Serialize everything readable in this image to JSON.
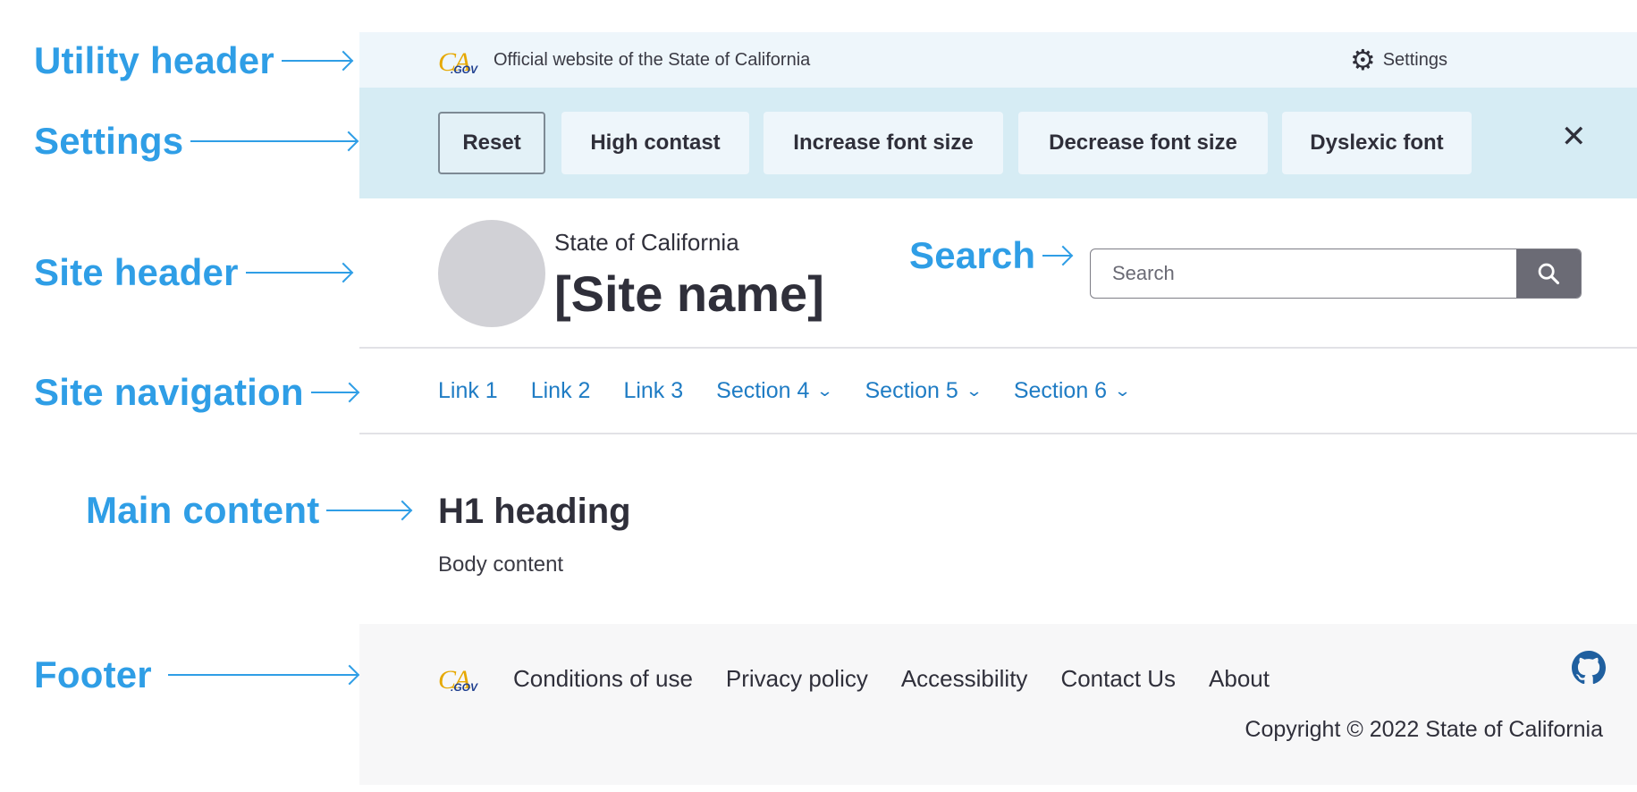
{
  "annotations": {
    "utility_header": "Utility header",
    "settings": "Settings",
    "site_header": "Site header",
    "search": "Search",
    "site_navigation": "Site navigation",
    "main_content": "Main content",
    "footer": "Footer"
  },
  "utility": {
    "logo_text": "CA",
    "logo_suffix": ".GOV",
    "official_text": "Official website of the State of California",
    "settings_label": "Settings",
    "settings_icon": "gear-icon"
  },
  "settings": {
    "buttons": [
      "Reset",
      "High contast",
      "Increase font size",
      "Decrease font size",
      "Dyslexic font"
    ],
    "close_icon": "close-icon"
  },
  "site_header": {
    "state_name": "State of California",
    "site_name": "[Site name]",
    "search_placeholder": "Search",
    "search_icon": "search-icon"
  },
  "nav": {
    "links": [
      "Link 1",
      "Link 2",
      "Link 3"
    ],
    "sections": [
      "Section 4",
      "Section 5",
      "Section 6"
    ]
  },
  "main": {
    "heading": "H1 heading",
    "body": "Body content"
  },
  "footer": {
    "links": [
      "Conditions of use",
      "Privacy policy",
      "Accessibility",
      "Contact Us",
      "About"
    ],
    "copyright": "Copyright © 2022 State of California",
    "github_icon": "github-icon"
  },
  "colors": {
    "annotation": "#2f9ee6",
    "utility_bg": "#eef6fb",
    "settings_bg": "#d6ecf4",
    "link": "#1f7cc4",
    "footer_bg": "#f7f7f8"
  }
}
